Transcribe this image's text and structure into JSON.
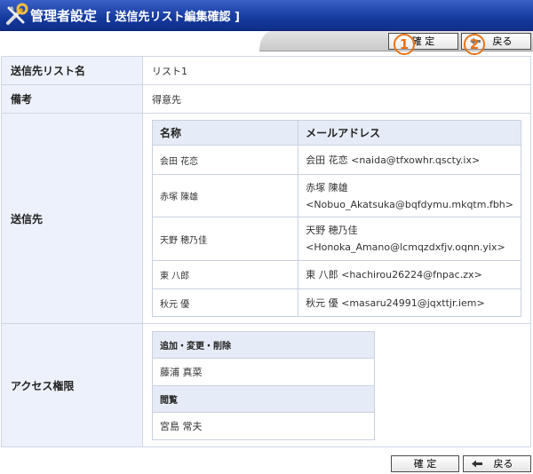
{
  "header": {
    "title": "管理者設定",
    "subtitle": "[ 送信先リスト編集確認 ]",
    "icon": "tools-icon",
    "color": "#143a9e"
  },
  "toolbar": {
    "confirm_label": "確 定",
    "back_label": "戻る",
    "marker_1": "1",
    "marker_2": "2",
    "marker_color": "#e87418"
  },
  "form": {
    "list_name": {
      "label": "送信先リスト名",
      "value": "リスト1"
    },
    "remarks": {
      "label": "備考",
      "value": "得意先"
    },
    "recipients": {
      "label": "送信先",
      "headers": [
        "名称",
        "メールアドレス"
      ],
      "rows": [
        {
          "name": "会田 花恋",
          "email": "会田 花恋 <naida@tfxowhr.qscty.ix>"
        },
        {
          "name": "赤塚 陳雄",
          "email": "赤塚 陳雄 <Nobuo_Akatsuka@bqfdymu.mkqtm.fbh>"
        },
        {
          "name": "天野 穂乃佳",
          "email": "天野 穂乃佳 <Honoka_Amano@lcmqzdxfjv.oqnn.yix>"
        },
        {
          "name": "東 八郎",
          "email": "東 八郎 <hachirou26224@fnpac.zx>"
        },
        {
          "name": "秋元 優",
          "email": "秋元 優 <masaru24991@jqxttjr.iem>"
        }
      ]
    },
    "access": {
      "label": "アクセス権限",
      "edit_header": "追加・変更・削除",
      "edit_user": "藤浦 真菜",
      "view_header": "閲覧",
      "view_user": "宮島 常夫"
    }
  },
  "footer": {
    "confirm_label": "確 定",
    "back_label": "戻る"
  }
}
